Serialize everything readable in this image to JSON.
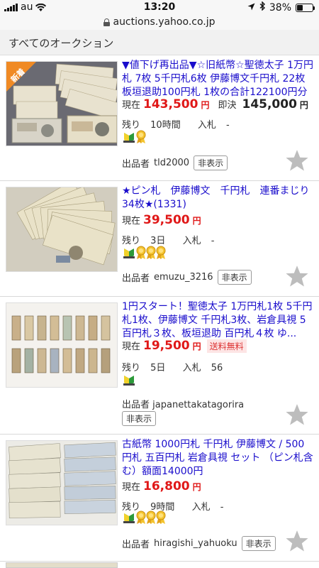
{
  "status_bar": {
    "carrier": "au",
    "time": "13:20",
    "battery": "38%",
    "battery_level": 0.38
  },
  "url_bar": {
    "url": "auctions.yahoo.co.jp"
  },
  "section_title": "すべてのオークション",
  "labels": {
    "current": "現在",
    "buy_now": "即決",
    "yen": "円",
    "remaining": "残り",
    "bids": "入札",
    "seller": "出品者",
    "hide": "非表示",
    "new": "新着",
    "free_shipping": "送料無料"
  },
  "items": [
    {
      "title": "▼値下げ再出品▼☆旧紙幣☆聖徳太子 1万円札 7枚 5千円札6枚 伊藤博文千円札 22枚 板垣退助100円札 1枚の合計122100円分",
      "price": "143,500",
      "buy_now": "145,000",
      "remaining": "10時間",
      "bids": "-",
      "seller": "tld2000",
      "is_new": true,
      "badges": [
        "beginner-icon",
        "gold-medal-icon"
      ]
    },
    {
      "title": "★ピン札　伊藤博文　千円札　連番まじり　34枚★(1331)",
      "price": "39,500",
      "remaining": "3日",
      "bids": "-",
      "seller": "emuzu_3216",
      "badges": [
        "beginner-icon",
        "gold-medal-icon",
        "gold-medal-icon",
        "gold-medal-icon"
      ]
    },
    {
      "title": "1円スタート！聖徳太子 1万円札1枚 5千円札1枚、伊藤博文 千円札3枚、岩倉具視 5百円札３枚、板垣退助 百円札４枚 ゆ...",
      "price": "19,500",
      "free_shipping": true,
      "remaining": "5日",
      "bids": "56",
      "seller": "japanettakatagorira",
      "badges": [
        "beginner-icon"
      ]
    },
    {
      "title": "古紙幣 1000円札 千円札 伊藤博文 / 500円札 五百円札 岩倉具視 セット （ピン札含む）額面14000円",
      "price": "16,800",
      "remaining": "9時間",
      "bids": "-",
      "seller": "hiragishi_yahuoku",
      "badges": [
        "beginner-icon",
        "gold-medal-icon",
        "gold-medal-icon",
        "gold-medal-icon"
      ]
    }
  ],
  "colors": {
    "link": "#1a0dcc",
    "price": "#e01818",
    "new_badge": "#f08a24",
    "star": "#bdbdbd"
  }
}
